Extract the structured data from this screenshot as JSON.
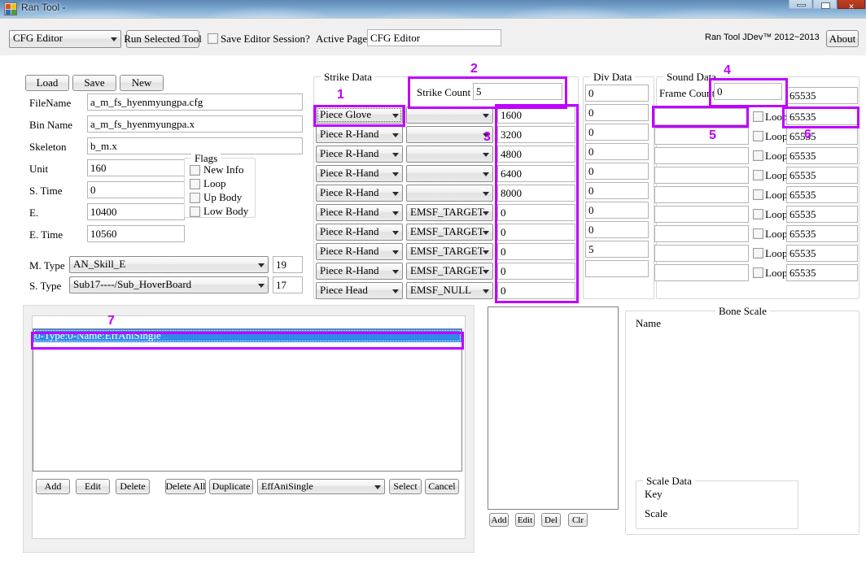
{
  "window": {
    "title": "Ran Tool -",
    "minimize": "–",
    "maximize": "□",
    "close": "✕"
  },
  "toolbar": {
    "tool_select_value": "CFG Editor",
    "run_button": "Run Selected Tool",
    "save_session_label": "Save Editor Session?",
    "active_page_label": "Active Page:",
    "active_page_value": "CFG Editor",
    "brand": "Ran Tool JDev™ 2012~2013",
    "about_button": "About"
  },
  "file_panel": {
    "load_button": "Load",
    "save_button": "Save",
    "new_button": "New",
    "fields": [
      {
        "label": "FileName",
        "value": "a_m_fs_hyenmyungpa.cfg"
      },
      {
        "label": "Bin Name",
        "value": "a_m_fs_hyenmyungpa.x"
      },
      {
        "label": "Skeleton",
        "value": "b_m.x"
      },
      {
        "label": "Unit",
        "value": "160"
      },
      {
        "label": "S. Time",
        "value": "0"
      },
      {
        "label": "E.",
        "value": "10400"
      },
      {
        "label": "E. Time",
        "value": "10560"
      }
    ],
    "flags_caption": "Flags",
    "flags": [
      {
        "label": "New Info",
        "checked": false
      },
      {
        "label": "Loop",
        "checked": false
      },
      {
        "label": "Up Body",
        "checked": false
      },
      {
        "label": "Low Body",
        "checked": false
      }
    ],
    "m_type_label": "M. Type",
    "m_type_value": "AN_Skill_E",
    "m_type_index": "19",
    "s_type_label": "S. Type",
    "s_type_value": "Sub17----/Sub_HoverBoard",
    "s_type_index": "17"
  },
  "strike_data": {
    "caption": "Strike Data",
    "strike_count_label": "Strike Count",
    "strike_count_value": "5",
    "rows": [
      {
        "piece": "Piece Glove",
        "flag": "",
        "frame": "1600"
      },
      {
        "piece": "Piece R-Hand",
        "flag": "",
        "frame": "3200"
      },
      {
        "piece": "Piece R-Hand",
        "flag": "",
        "frame": "4800"
      },
      {
        "piece": "Piece R-Hand",
        "flag": "",
        "frame": "6400"
      },
      {
        "piece": "Piece R-Hand",
        "flag": "",
        "frame": "8000"
      },
      {
        "piece": "Piece R-Hand",
        "flag": "EMSF_TARGET",
        "frame": "0"
      },
      {
        "piece": "Piece R-Hand",
        "flag": "EMSF_TARGET",
        "frame": "0"
      },
      {
        "piece": "Piece R-Hand",
        "flag": "EMSF_TARGET",
        "frame": "0"
      },
      {
        "piece": "Piece R-Hand",
        "flag": "EMSF_TARGET",
        "frame": "0"
      },
      {
        "piece": "Piece Head",
        "flag": "EMSF_NULL",
        "frame": "0"
      }
    ]
  },
  "div_data": {
    "caption": "Div Data",
    "values": [
      "0",
      "0",
      "0",
      "0",
      "0",
      "0",
      "0",
      "0",
      "5"
    ]
  },
  "sound_data": {
    "caption": "Sound Data",
    "frame_count_label": "Frame Count",
    "frame_count_value": "0",
    "loop_label": "Loop",
    "rows": [
      {
        "name": "",
        "loop": false,
        "value": "65535",
        "has_loop": false
      },
      {
        "name": "",
        "loop": false,
        "value": "65535",
        "has_loop": true
      },
      {
        "name": "",
        "loop": false,
        "value": "65535",
        "has_loop": true
      },
      {
        "name": "",
        "loop": false,
        "value": "65535",
        "has_loop": true
      },
      {
        "name": "",
        "loop": false,
        "value": "65535",
        "has_loop": true
      },
      {
        "name": "",
        "loop": false,
        "value": "65535",
        "has_loop": true
      },
      {
        "name": "",
        "loop": false,
        "value": "65535",
        "has_loop": true
      },
      {
        "name": "",
        "loop": false,
        "value": "65535",
        "has_loop": true
      },
      {
        "name": "",
        "loop": false,
        "value": "65535",
        "has_loop": true
      },
      {
        "name": "",
        "loop": false,
        "value": "65535",
        "has_loop": true
      }
    ]
  },
  "effect_panel": {
    "items": [
      {
        "text": "0-Type:0-Name:EffAniSingle",
        "selected": true
      }
    ],
    "add_button": "Add",
    "edit_button": "Edit",
    "delete_button": "Delete",
    "delete_all_button": "Delete All",
    "duplicate_button": "Duplicate",
    "type_select_value": "EffAniSingle",
    "select_button": "Select",
    "cancel_button": "Cancel"
  },
  "bone_panel": {
    "add_button": "Add",
    "edit_button": "Edit",
    "del_button": "Del",
    "clr_button": "Clr",
    "bone_scale_caption": "Bone Scale",
    "name_label": "Name",
    "scale_data_caption": "Scale Data",
    "key_label": "Key",
    "scale_label": "Scale"
  },
  "annotations": [
    {
      "num": "1"
    },
    {
      "num": "2"
    },
    {
      "num": "3"
    },
    {
      "num": "4"
    },
    {
      "num": "5"
    },
    {
      "num": "6"
    },
    {
      "num": "7"
    }
  ],
  "colors": {
    "annotation": "#bf00ff",
    "selection": "#2f8ae8"
  }
}
